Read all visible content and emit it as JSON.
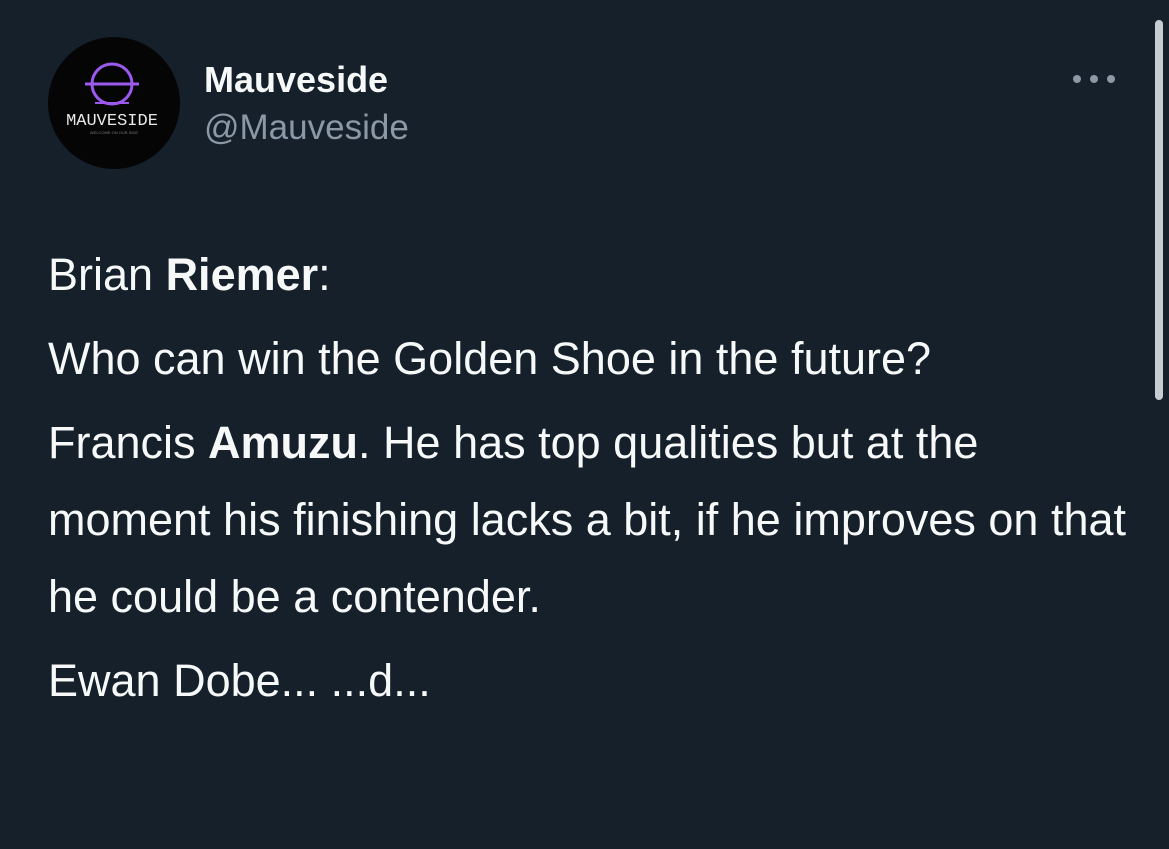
{
  "account": {
    "display_name": "Mauveside",
    "handle": "@Mauveside",
    "avatar": {
      "logo_text": "MAUVESIDE",
      "tagline": "WELCOME ON OUR SIDE",
      "accent_color": "#9b59f0"
    }
  },
  "more_icon": "more-horizontal-icon",
  "tweet": {
    "speaker": {
      "first": "Brian ",
      "last": "Riemer",
      "suffix": ":"
    },
    "question": "Who can win the Golden Shoe in the future?",
    "answer": {
      "first": "Francis ",
      "last": "Amuzu",
      "rest": ". He has top qualities but at the moment his finishing lacks a bit, if he improves on that he could be a contender."
    },
    "next_line_partial": "Ewan Dobe... ...d..."
  },
  "colors": {
    "background": "#15202b",
    "text_primary": "#f7f9f9",
    "text_secondary": "#8b98a5"
  }
}
